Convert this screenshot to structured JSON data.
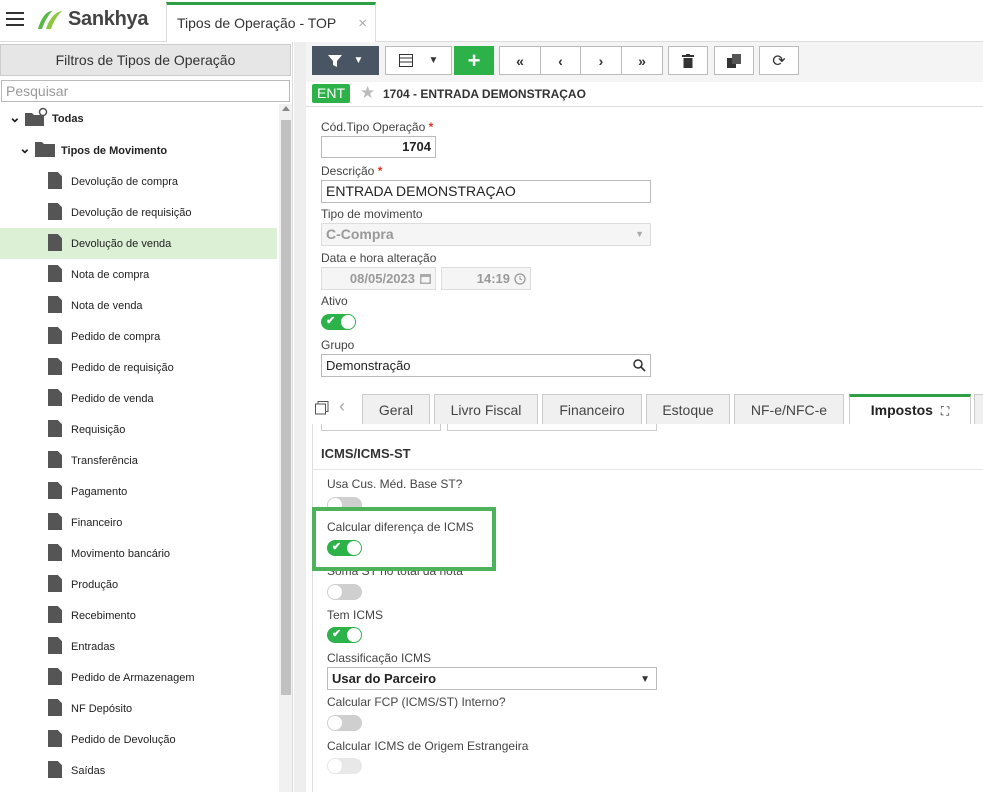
{
  "app": {
    "brand": "Sankhya",
    "tab_title": "Tipos de Operação - TOP",
    "tab_close": "×"
  },
  "left_panel": {
    "header": "Filtros de Tipos de Operação",
    "search_placeholder": "Pesquisar",
    "root": "Todas",
    "group": "Tipos de Movimento",
    "items": [
      "Devolução de compra",
      "Devolução de requisição",
      "Devolução de venda",
      "Nota de compra",
      "Nota de venda",
      "Pedido de compra",
      "Pedido de requisição",
      "Pedido de venda",
      "Requisição",
      "Transferência",
      "Pagamento",
      "Financeiro",
      "Movimento bancário",
      "Produção",
      "Recebimento",
      "Entradas",
      "Pedido de Armazenagem",
      "NF Depósito",
      "Pedido de Devolução",
      "Saídas"
    ],
    "selected": "Devolução de venda"
  },
  "record": {
    "badge": "ENT",
    "title": "1704 - ENTRADA DEMONSTRAÇAO"
  },
  "form": {
    "cod_label": "Cód.Tipo Operação",
    "cod_value": "1704",
    "desc_label": "Descrição",
    "desc_value": "ENTRADA DEMONSTRAÇAO",
    "tipo_label": "Tipo de movimento",
    "tipo_value": "C-Compra",
    "data_label": "Data e hora alteração",
    "data_value": "08/05/2023",
    "hora_value": "14:19",
    "ativo_label": "Ativo",
    "grupo_label": "Grupo",
    "grupo_value": "Demonstração",
    "required_mark": "*"
  },
  "tabs": [
    "Geral",
    "Livro Fiscal",
    "Financeiro",
    "Estoque",
    "NF-e/NFC-e",
    "Impostos"
  ],
  "active_tab": "Impostos",
  "impostos": {
    "section": "ICMS/ICMS-ST",
    "usa_cus": "Usa Cus. Méd. Base ST?",
    "calcular_dif": "Calcular diferença de ICMS",
    "soma_st": "Soma ST no total da nota",
    "tem_icms": "Tem ICMS",
    "classif_label": "Classificação ICMS",
    "classif_value": "Usar do Parceiro",
    "fcp": "Calcular FCP (ICMS/ST) Interno?",
    "icms_origem": "Calcular ICMS de Origem Estrangeira"
  },
  "colors": {
    "accent": "#2db24a",
    "highlight": "#4db35a",
    "selected_row": "#dcf0d6"
  }
}
